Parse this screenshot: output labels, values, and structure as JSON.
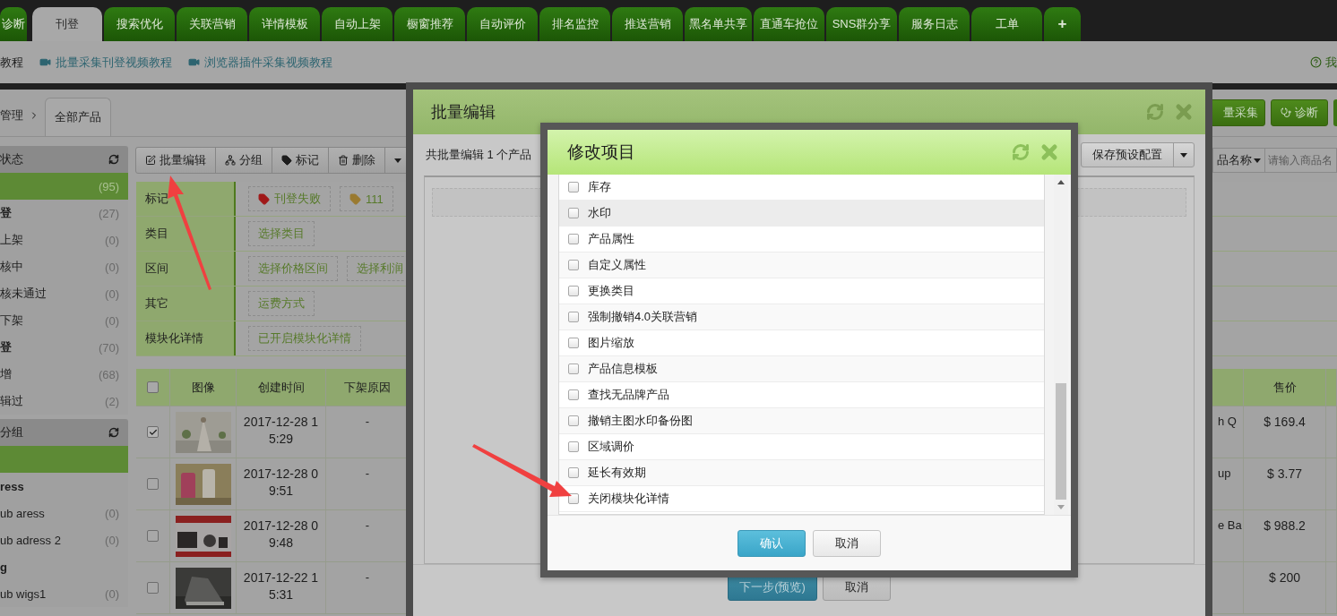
{
  "nav_tabs": [
    {
      "label": "诊断",
      "selected": false
    },
    {
      "label": "刊登",
      "selected": true
    },
    {
      "label": "搜索优化",
      "selected": false
    },
    {
      "label": "关联营销",
      "selected": false
    },
    {
      "label": "详情模板",
      "selected": false
    },
    {
      "label": "自动上架",
      "selected": false
    },
    {
      "label": "橱窗推荐",
      "selected": false
    },
    {
      "label": "自动评价",
      "selected": false
    },
    {
      "label": "排名监控",
      "selected": false
    },
    {
      "label": "推送营销",
      "selected": false
    },
    {
      "label": "黑名单共享",
      "selected": false
    },
    {
      "label": "直通车抢位",
      "selected": false
    },
    {
      "label": "SNS群分享",
      "selected": false
    },
    {
      "label": "服务日志",
      "selected": false
    },
    {
      "label": "工单",
      "selected": false
    },
    {
      "label": "+",
      "selected": false
    }
  ],
  "tutorial_links": [
    {
      "label": "教程",
      "kind": "text"
    },
    {
      "label": "批量采集刊登视频教程",
      "kind": "video"
    },
    {
      "label": "浏览器插件采集视频教程",
      "kind": "video"
    }
  ],
  "help_link": "我",
  "breadcrumb": {
    "parent": "管理",
    "tab": "全部产品"
  },
  "top_actions": [
    {
      "label": "量采集",
      "kind": "plain"
    },
    {
      "label": "诊断",
      "kind": "diagnose"
    }
  ],
  "sidebar": [
    {
      "title": "状态",
      "items": [
        {
          "count": "(95)",
          "selected": true,
          "bold": false
        },
        {
          "label": "登",
          "count": "(27)",
          "selected": false,
          "bold": true
        },
        {
          "label": "上架",
          "count": "(0)",
          "selected": false,
          "bold": false
        },
        {
          "label": "核中",
          "count": "(0)",
          "selected": false,
          "bold": false
        },
        {
          "label": "核未通过",
          "count": "(0)",
          "selected": false,
          "bold": false
        },
        {
          "label": "下架",
          "count": "(0)",
          "selected": false,
          "bold": false
        },
        {
          "label": "登",
          "count": "(70)",
          "selected": false,
          "bold": true
        },
        {
          "label": "增",
          "count": "(68)",
          "selected": false,
          "bold": false
        },
        {
          "label": "辑过",
          "count": "(2)",
          "selected": false,
          "bold": false
        }
      ]
    },
    {
      "title": "分组",
      "items": [
        {
          "selected": true,
          "bold": false
        },
        {
          "label": "ress",
          "selected": false,
          "bold": true
        },
        {
          "label": "ub aress",
          "count": "(0)",
          "selected": false,
          "bold": false
        },
        {
          "label": "ub adress 2",
          "count": "(0)",
          "selected": false,
          "bold": false
        },
        {
          "label": "g",
          "selected": false,
          "bold": true
        },
        {
          "label": "ub wigs1",
          "count": "(0)",
          "selected": false,
          "bold": false
        }
      ]
    }
  ],
  "toolbar": [
    {
      "label": "批量编辑",
      "kind": "edit"
    },
    {
      "label": "分组",
      "kind": "group"
    },
    {
      "label": "标记",
      "kind": "tag"
    },
    {
      "label": "删除",
      "kind": "delete"
    },
    {
      "kind": "caret"
    }
  ],
  "search": {
    "field_menu": "品名称",
    "placeholder": "请输入商品名"
  },
  "filters": [
    {
      "label": "标记",
      "options": [
        {
          "label": "刊登失败",
          "color": "#a01818"
        },
        {
          "label": "111",
          "color": "#9a7a30"
        }
      ]
    },
    {
      "label": "类目",
      "options": [
        {
          "label": "选择类目"
        }
      ]
    },
    {
      "label": "区间",
      "options": [
        {
          "label": "选择价格区间"
        },
        {
          "label": "选择利润"
        }
      ]
    },
    {
      "label": "其它",
      "options": [
        {
          "label": "运费方式"
        }
      ]
    },
    {
      "label": "模块化详情",
      "options": [
        {
          "label": "已开启模块化详情"
        }
      ]
    }
  ],
  "table": {
    "select_all_checked": false,
    "columns": [
      "图像",
      "创建时间",
      "下架原因",
      "售价"
    ],
    "rows": [
      {
        "checked": true,
        "created": "2017-12-28 15:29",
        "reason": "-",
        "column_5": "h Q",
        "price": "$ 169.4"
      },
      {
        "checked": false,
        "created": "2017-12-28 09:51",
        "reason": "-",
        "column_5": "up",
        "price": "$ 3.77"
      },
      {
        "checked": false,
        "created": "2017-12-28 09:48",
        "reason": "-",
        "column_5": "e Ba",
        "price": "$ 988.2"
      },
      {
        "checked": false,
        "created": "2017-12-22 15:31",
        "reason": "-",
        "price": "$ 200"
      }
    ]
  },
  "batch_edit_dialog": {
    "title": "批量编辑",
    "summary": "共批量编辑 1 个产品",
    "preset_button": "保存预设配置",
    "next_button": "下一步(预览)",
    "cancel_button": "取消"
  },
  "modify_items_dialog": {
    "title": "修改项目",
    "items": [
      {
        "label": "库存",
        "checked": false,
        "hovered": false
      },
      {
        "label": "水印",
        "checked": false,
        "hovered": true
      },
      {
        "label": "产品属性",
        "checked": false,
        "hovered": false
      },
      {
        "label": "自定义属性",
        "checked": false,
        "hovered": false
      },
      {
        "label": "更换类目",
        "checked": false,
        "hovered": false
      },
      {
        "label": "强制撤销4.0关联营销",
        "checked": false,
        "hovered": false
      },
      {
        "label": "图片缩放",
        "checked": false,
        "hovered": false
      },
      {
        "label": "产品信息模板",
        "checked": false,
        "hovered": false
      },
      {
        "label": "查找无品牌产品",
        "checked": false,
        "hovered": false
      },
      {
        "label": "撤销主图水印备份图",
        "checked": false,
        "hovered": false
      },
      {
        "label": "区域调价",
        "checked": false,
        "hovered": false
      },
      {
        "label": "延长有效期",
        "checked": false,
        "hovered": false
      },
      {
        "label": "关闭模块化详情",
        "checked": false,
        "hovered": false
      }
    ],
    "confirm_button": "确认",
    "cancel_button": "取消"
  }
}
